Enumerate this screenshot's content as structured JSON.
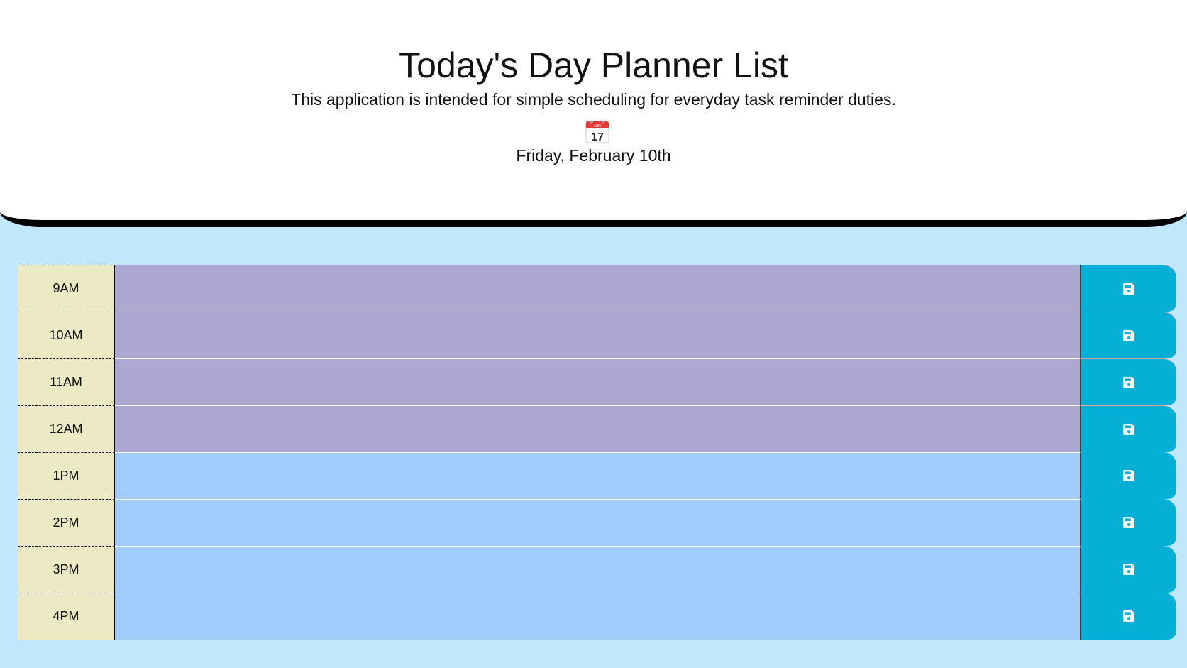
{
  "header": {
    "title": "Today's Day Planner List",
    "lead": "This application is intended for simple scheduling for everyday task reminder duties.",
    "calendar_icon": {
      "icon": "calendar-icon",
      "month": "July",
      "day": "17",
      "accent": "#e53935"
    },
    "current_day": "Friday, February 10th"
  },
  "colors": {
    "page_background": "#c1e7fd",
    "hour_background": "#eceac5",
    "past": "#ada8d2",
    "future": "#a1cdfd",
    "save_button": "#06afd6"
  },
  "planner": {
    "rows": [
      {
        "hour": "9AM",
        "status": "past",
        "description": "",
        "save_icon": "save-icon"
      },
      {
        "hour": "10AM",
        "status": "past",
        "description": "",
        "save_icon": "save-icon"
      },
      {
        "hour": "11AM",
        "status": "past",
        "description": "",
        "save_icon": "save-icon"
      },
      {
        "hour": "12AM",
        "status": "past",
        "description": "",
        "save_icon": "save-icon"
      },
      {
        "hour": "1PM",
        "status": "future",
        "description": "",
        "save_icon": "save-icon"
      },
      {
        "hour": "2PM",
        "status": "future",
        "description": "",
        "save_icon": "save-icon"
      },
      {
        "hour": "3PM",
        "status": "future",
        "description": "",
        "save_icon": "save-icon"
      },
      {
        "hour": "4PM",
        "status": "future",
        "description": "",
        "save_icon": "save-icon"
      }
    ]
  }
}
